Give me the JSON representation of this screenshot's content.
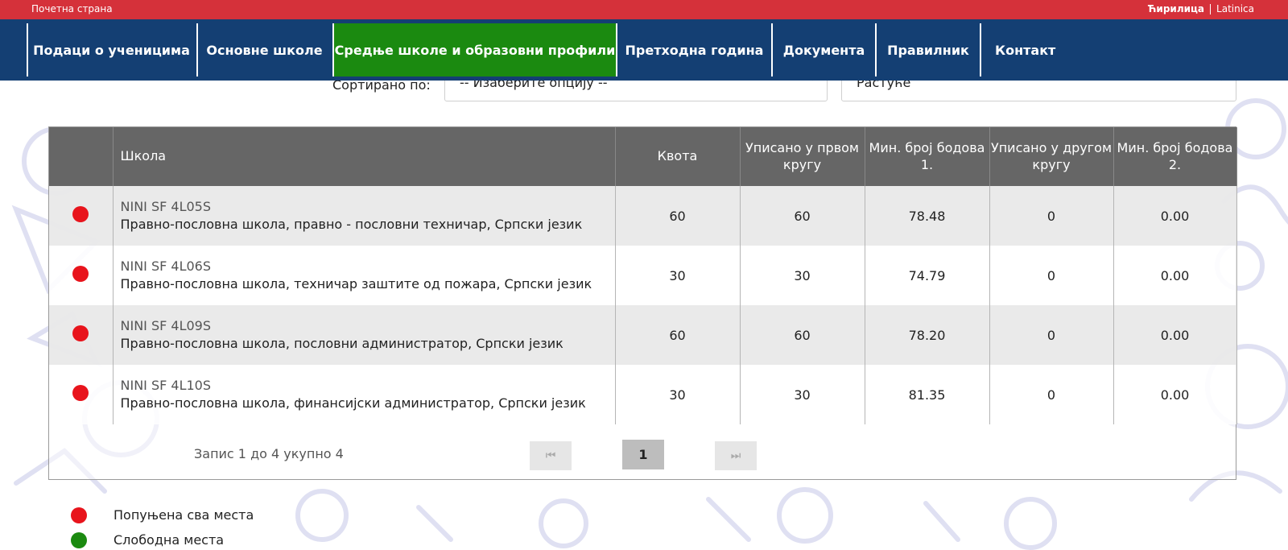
{
  "topbar": {
    "home_label": "Почетна страна",
    "lang_cyrillic": "Ћирилица",
    "lang_latin": "Latinica"
  },
  "nav": {
    "items": [
      {
        "label": "Подаци о ученицима"
      },
      {
        "label": "Основне школе"
      },
      {
        "label": "Средње школе и образовни профили",
        "active": true
      },
      {
        "label": "Претходна година"
      },
      {
        "label": "Документа"
      },
      {
        "label": "Правилник"
      },
      {
        "label": "Контакт"
      }
    ]
  },
  "sort": {
    "label": "Сортирано по:",
    "option_value": "-- Изаберите опцију --",
    "order_value": "Растуће"
  },
  "table": {
    "headers": {
      "status": "",
      "school": "Школа",
      "quota": "Квота",
      "enrolled_round1": "Уписано у првом кругу",
      "min_points1": "Мин. број бодова 1.",
      "enrolled_round2": "Уписано у другом кругу",
      "min_points2": "Мин. број бодова 2."
    },
    "rows": [
      {
        "status": "full",
        "code": "NINI SF 4L05S",
        "name": "Правно-пословна школа, правно - пословни техничар, Српски језик",
        "quota": "60",
        "enrolled1": "60",
        "min1": "78.48",
        "enrolled2": "0",
        "min2": "0.00"
      },
      {
        "status": "full",
        "code": "NINI SF 4L06S",
        "name": "Правно-пословна школа, техничар заштите од пожара, Српски језик",
        "quota": "30",
        "enrolled1": "30",
        "min1": "74.79",
        "enrolled2": "0",
        "min2": "0.00"
      },
      {
        "status": "full",
        "code": "NINI SF 4L09S",
        "name": "Правно-пословна школа, пословни администратор, Српски језик",
        "quota": "60",
        "enrolled1": "60",
        "min1": "78.20",
        "enrolled2": "0",
        "min2": "0.00"
      },
      {
        "status": "full",
        "code": "NINI SF 4L10S",
        "name": "Правно-пословна школа, финансијски администратор, Српски језик",
        "quota": "30",
        "enrolled1": "30",
        "min1": "81.35",
        "enrolled2": "0",
        "min2": "0.00"
      }
    ]
  },
  "pager": {
    "info": "Запис 1 до 4 укупно 4",
    "first_icon": "⏮",
    "current_page": "1",
    "last_icon": "⏭"
  },
  "legend": {
    "full_label": "Попуњена сва места",
    "free_label": "Слободна места"
  },
  "colors": {
    "topbar": "#d5313a",
    "navbar": "#143f73",
    "nav_active": "#1b8a10",
    "status_full": "#e8141c",
    "status_free": "#1b8a10",
    "table_header": "#666666"
  }
}
